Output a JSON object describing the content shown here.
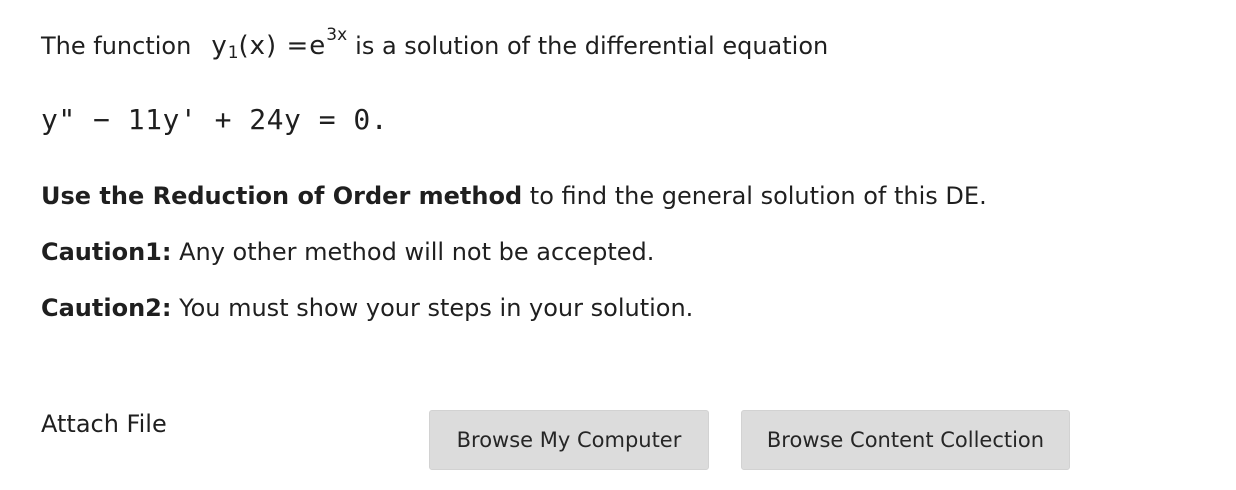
{
  "question": {
    "intro_text": "The function",
    "function_y": "y",
    "function_sub": "1",
    "function_arg": "(x) =e",
    "function_exp": "3x",
    "intro_suffix": "is a solution of the differential equation",
    "equation": "y\" − 11y' + 24y = 0.",
    "instruction_bold": "Use the Reduction of Order method",
    "instruction_rest": " to find the general solution of this DE.",
    "caution1_label": "Caution1:",
    "caution1_text": " Any other method will not be accepted.",
    "caution2_label": "Caution2:",
    "caution2_text": " You must show your steps in your solution."
  },
  "attach": {
    "label": "Attach File",
    "browse_computer": "Browse My Computer",
    "browse_content": "Browse Content Collection"
  }
}
